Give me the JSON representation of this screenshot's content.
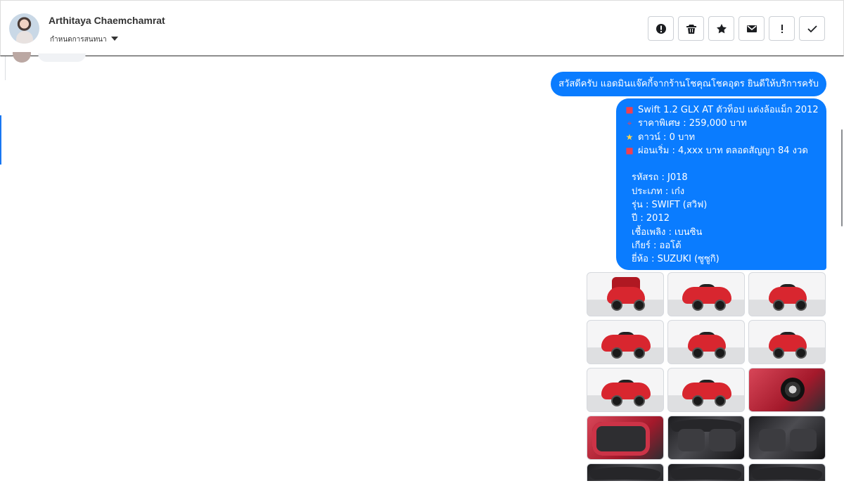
{
  "conversation": {
    "contact_name": "Arthitaya Chaemchamrat",
    "status_label": "กำหนดการสนทนา"
  },
  "toolbar": {
    "actions": [
      {
        "name": "alert-icon"
      },
      {
        "name": "trash-icon"
      },
      {
        "name": "star-icon"
      },
      {
        "name": "mail-icon"
      },
      {
        "name": "exclamation-icon"
      },
      {
        "name": "check-icon"
      }
    ]
  },
  "messages": {
    "greeting": "สวัสดีครับ แอดมินแจ๊คกี้จากร้านโชคุณโชคอุดร ยินดีให้บริการครับ",
    "details": {
      "title": "Swift 1.2 GLX AT ตัวท็อป แต่งล้อแม็ก 2012",
      "price": "ราคาพิเศษ : 259,000 บาท",
      "down": "ดาวน์ : 0 บาท",
      "installment": "ผ่อนเริ่ม : 4,xxx บาท ตลอดสัญญา 84 งวด",
      "code": "รหัสรถ : J018",
      "type": "ประเภท : เก๋ง",
      "model": "รุ่น : SWIFT (สวิฟ)",
      "year": "ปี : 2012",
      "fuel": "เชื้อเพลิง : เบนซิน",
      "gear": "เกียร์ : ออโต้",
      "brand": "ยี่ห้อ : SUZUKI (ซูซูกิ)"
    },
    "icons": {
      "title": "car-icon",
      "price": "pin-icon",
      "down": "star-icon",
      "installment": "car-icon"
    }
  },
  "photos": [
    {
      "name": "car-photo-1",
      "kind": "open-hatch"
    },
    {
      "name": "car-photo-2",
      "kind": "front"
    },
    {
      "name": "car-photo-3",
      "kind": "front"
    },
    {
      "name": "car-photo-4",
      "kind": "side"
    },
    {
      "name": "car-photo-5",
      "kind": "rear"
    },
    {
      "name": "car-photo-6",
      "kind": "rear"
    },
    {
      "name": "car-photo-7",
      "kind": "side"
    },
    {
      "name": "car-photo-8",
      "kind": "side"
    },
    {
      "name": "car-photo-9",
      "kind": "wheel"
    },
    {
      "name": "car-photo-10",
      "kind": "door"
    },
    {
      "name": "car-photo-11",
      "kind": "dashboard"
    },
    {
      "name": "car-photo-12",
      "kind": "seat"
    },
    {
      "name": "car-photo-13",
      "kind": "interior"
    },
    {
      "name": "car-photo-14",
      "kind": "interior"
    },
    {
      "name": "car-photo-15",
      "kind": "interior"
    }
  ],
  "colors": {
    "message_blue": "#0a7cff",
    "header_text": "#333333",
    "border": "#ccd0d5",
    "car_red": "#d8262f"
  }
}
